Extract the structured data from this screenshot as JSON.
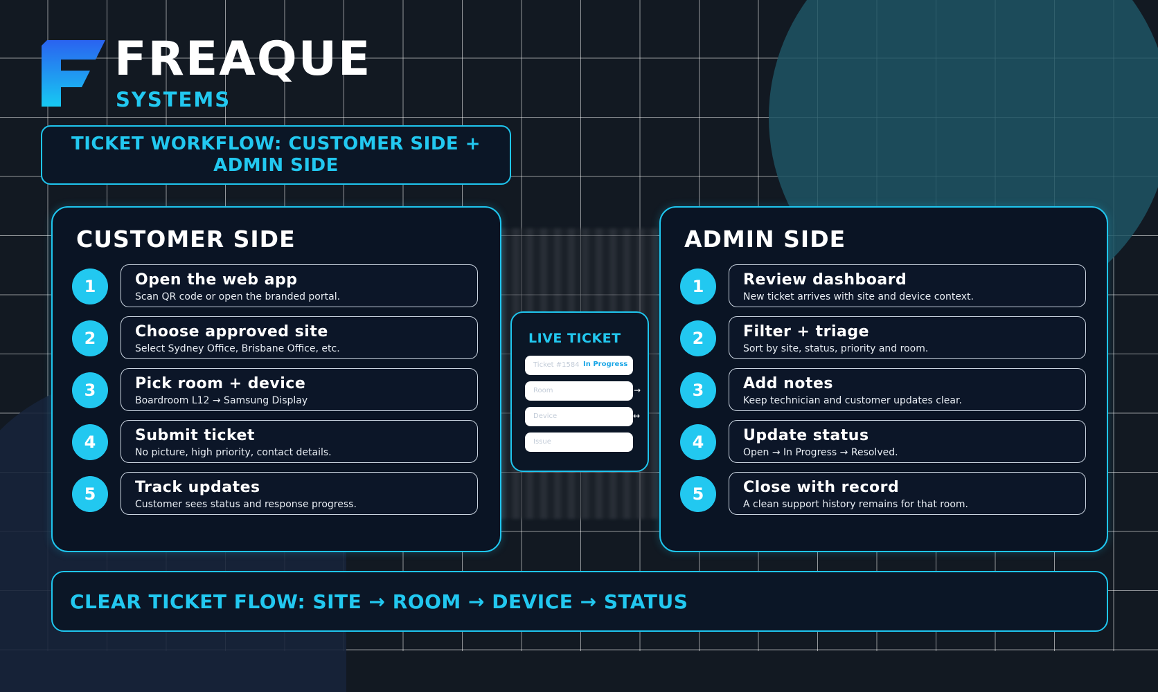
{
  "brand": {
    "name": "FREAQUE",
    "sub": "SYSTEMS"
  },
  "title": "TICKET WORKFLOW: CUSTOMER SIDE + ADMIN SIDE",
  "customer": {
    "heading": "CUSTOMER SIDE",
    "steps": [
      {
        "num": "1",
        "title": "Open the web app",
        "desc": "Scan QR code or open the branded portal."
      },
      {
        "num": "2",
        "title": "Choose approved site",
        "desc": "Select Sydney Office, Brisbane Office, etc."
      },
      {
        "num": "3",
        "title": "Pick room + device",
        "desc": "Boardroom L12 → Samsung Display"
      },
      {
        "num": "4",
        "title": "Submit ticket",
        "desc": "No picture, high priority, contact details."
      },
      {
        "num": "5",
        "title": "Track updates",
        "desc": "Customer sees status and response progress."
      }
    ]
  },
  "admin": {
    "heading": "ADMIN SIDE",
    "steps": [
      {
        "num": "1",
        "title": "Review dashboard",
        "desc": "New ticket arrives with site and device context."
      },
      {
        "num": "2",
        "title": "Filter + triage",
        "desc": "Sort by site, status, priority and room."
      },
      {
        "num": "3",
        "title": "Add notes",
        "desc": "Keep technician and customer updates clear."
      },
      {
        "num": "4",
        "title": "Update status",
        "desc": "Open → In Progress → Resolved."
      },
      {
        "num": "5",
        "title": "Close with record",
        "desc": "A clean support history remains for that room."
      }
    ]
  },
  "live_ticket": {
    "title": "LIVE TICKET",
    "ticket_label": "Ticket #1584",
    "status": "In Progress",
    "fields": [
      "Room",
      "Device",
      "Issue"
    ]
  },
  "footer": "CLEAR TICKET FLOW: SITE → ROOM → DEVICE → STATUS"
}
